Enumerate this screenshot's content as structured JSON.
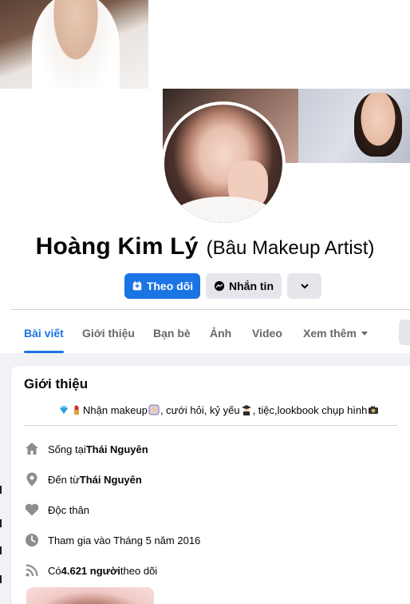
{
  "profile": {
    "name": "Hoàng Kim Lý",
    "alternate_name": "(Bâu Makeup Artist)"
  },
  "actions": {
    "follow_label": "Theo dõi",
    "message_label": "Nhắn tin"
  },
  "tabs": [
    {
      "label": "Bài viết",
      "active": true
    },
    {
      "label": "Giới thiệu",
      "active": false
    },
    {
      "label": "Bạn bè",
      "active": false
    },
    {
      "label": "Ảnh",
      "active": false
    },
    {
      "label": "Video",
      "active": false
    },
    {
      "label": "Xem thêm",
      "active": false
    }
  ],
  "intro": {
    "title": "Giới thiệu",
    "bio_text_1": "Nhận makeup",
    "bio_text_2": ", cưới hỏi, kỷ yếu",
    "bio_text_3": ", tiệc,lookbook chụp hình",
    "bio_emojis": [
      "gem-emoji",
      "lipstick-emoji",
      "face-emoji",
      "graduate-emoji",
      "camera-emoji"
    ],
    "items": [
      {
        "icon": "home-icon",
        "prefix": "Sống tại ",
        "bold": "Thái Nguyên",
        "suffix": ""
      },
      {
        "icon": "location-pin-icon",
        "prefix": "Đến từ ",
        "bold": "Thái Nguyên",
        "suffix": ""
      },
      {
        "icon": "heart-icon",
        "prefix": "Độc thân",
        "bold": "",
        "suffix": ""
      },
      {
        "icon": "clock-icon",
        "prefix": "Tham gia vào Tháng 5 năm 2016",
        "bold": "",
        "suffix": ""
      },
      {
        "icon": "rss-icon",
        "prefix": "Có ",
        "bold": "4.621 người",
        "suffix": " theo dõi"
      }
    ]
  },
  "colors": {
    "accent": "#1b74e4",
    "secondary_button": "#e4e6eb",
    "muted_text": "#65676b",
    "background": "#f0f2f5"
  }
}
